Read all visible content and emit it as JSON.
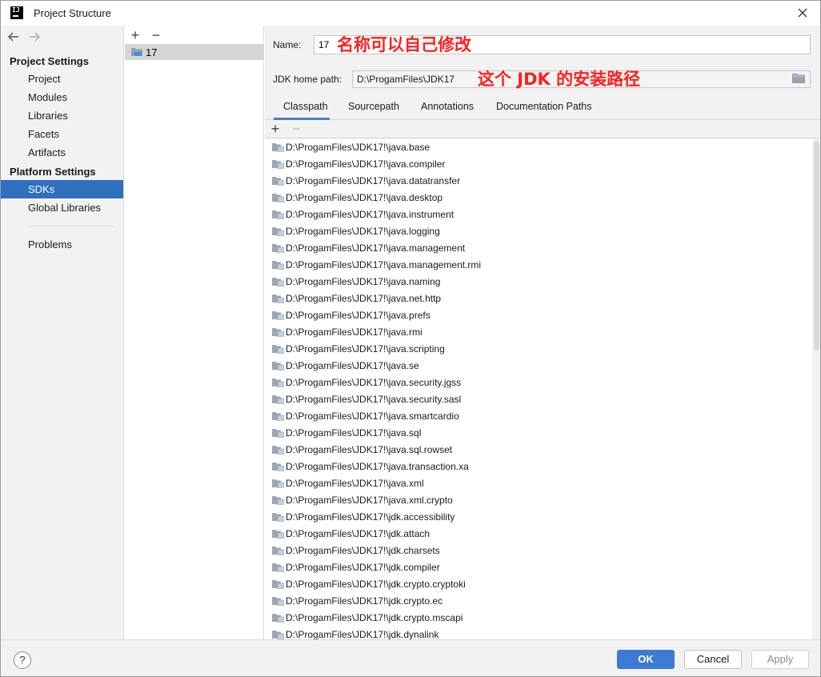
{
  "window": {
    "title": "Project Structure",
    "app_icon_text": "IJ"
  },
  "nav": {
    "project_settings_heading": "Project Settings",
    "project_items": [
      "Project",
      "Modules",
      "Libraries",
      "Facets",
      "Artifacts"
    ],
    "platform_settings_heading": "Platform Settings",
    "platform_items": [
      "SDKs",
      "Global Libraries"
    ],
    "selected": "SDKs",
    "problems": "Problems"
  },
  "sdk_list": {
    "add": "+",
    "remove": "−",
    "items": [
      "17"
    ]
  },
  "detail": {
    "name_label": "Name:",
    "name_value": "17",
    "home_path_label": "JDK home path:",
    "home_path_value": "D:\\ProgamFiles\\JDK17",
    "annotation_name": "名称可以自己修改",
    "annotation_path": "这个 JDK 的安装路径",
    "tabs": [
      "Classpath",
      "Sourcepath",
      "Annotations",
      "Documentation Paths"
    ],
    "active_tab": "Classpath",
    "add": "+",
    "remove": "−",
    "classpath": [
      "D:\\ProgamFiles\\JDK17!\\java.base",
      "D:\\ProgamFiles\\JDK17!\\java.compiler",
      "D:\\ProgamFiles\\JDK17!\\java.datatransfer",
      "D:\\ProgamFiles\\JDK17!\\java.desktop",
      "D:\\ProgamFiles\\JDK17!\\java.instrument",
      "D:\\ProgamFiles\\JDK17!\\java.logging",
      "D:\\ProgamFiles\\JDK17!\\java.management",
      "D:\\ProgamFiles\\JDK17!\\java.management.rmi",
      "D:\\ProgamFiles\\JDK17!\\java.naming",
      "D:\\ProgamFiles\\JDK17!\\java.net.http",
      "D:\\ProgamFiles\\JDK17!\\java.prefs",
      "D:\\ProgamFiles\\JDK17!\\java.rmi",
      "D:\\ProgamFiles\\JDK17!\\java.scripting",
      "D:\\ProgamFiles\\JDK17!\\java.se",
      "D:\\ProgamFiles\\JDK17!\\java.security.jgss",
      "D:\\ProgamFiles\\JDK17!\\java.security.sasl",
      "D:\\ProgamFiles\\JDK17!\\java.smartcardio",
      "D:\\ProgamFiles\\JDK17!\\java.sql",
      "D:\\ProgamFiles\\JDK17!\\java.sql.rowset",
      "D:\\ProgamFiles\\JDK17!\\java.transaction.xa",
      "D:\\ProgamFiles\\JDK17!\\java.xml",
      "D:\\ProgamFiles\\JDK17!\\java.xml.crypto",
      "D:\\ProgamFiles\\JDK17!\\jdk.accessibility",
      "D:\\ProgamFiles\\JDK17!\\jdk.attach",
      "D:\\ProgamFiles\\JDK17!\\jdk.charsets",
      "D:\\ProgamFiles\\JDK17!\\jdk.compiler",
      "D:\\ProgamFiles\\JDK17!\\jdk.crypto.cryptoki",
      "D:\\ProgamFiles\\JDK17!\\jdk.crypto.ec",
      "D:\\ProgamFiles\\JDK17!\\jdk.crypto.mscapi",
      "D:\\ProgamFiles\\JDK17!\\jdk.dynalink"
    ]
  },
  "buttons": {
    "help": "?",
    "ok": "OK",
    "cancel": "Cancel",
    "apply": "Apply"
  },
  "colors": {
    "selection": "#2f6fbf",
    "primary_button": "#3d7bd2",
    "annotation": "#ff1f1f",
    "tab_underline": "#4a7fc4"
  }
}
